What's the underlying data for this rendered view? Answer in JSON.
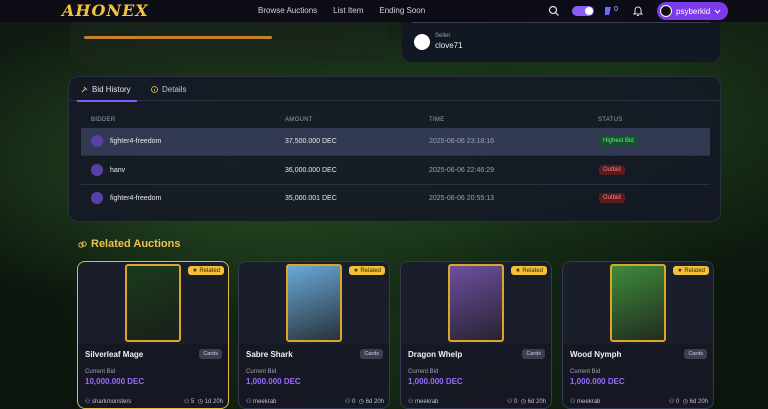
{
  "header": {
    "logo": "AHONEX",
    "nav": [
      "Browse Auctions",
      "List Item",
      "Ending Soon"
    ],
    "credits": "0",
    "username": "psyberkid"
  },
  "seller": {
    "label": "Seller",
    "name": "clove71"
  },
  "tabs": {
    "bid_history": "Bid History",
    "details": "Details"
  },
  "bid_table": {
    "headers": [
      "BIDDER",
      "AMOUNT",
      "TIME",
      "STATUS"
    ],
    "rows": [
      {
        "bidder": "fighter4-freedom",
        "amount": "37,500.000 DEC",
        "time": "2025-06-06 23:18:16",
        "status": "Highest Bid"
      },
      {
        "bidder": "hanv",
        "amount": "36,000.000 DEC",
        "time": "2025-06-06 22:46:29",
        "status": "Outbid"
      },
      {
        "bidder": "fighter4-freedom",
        "amount": "35,000.001 DEC",
        "time": "2025-06-06 20:55:13",
        "status": "Outbid"
      }
    ]
  },
  "related": {
    "title": "Related Auctions",
    "cards": [
      {
        "name": "Silverleaf Mage",
        "category": "Cards",
        "badge": "Related",
        "bid_label": "Current Bid",
        "price": "10,000.000 DEC",
        "seller": "sharkmonsters",
        "bids": "5",
        "time_left": "1d 20h",
        "art_color": "#1b3a1b"
      },
      {
        "name": "Sabre Shark",
        "category": "Cards",
        "badge": "Related",
        "bid_label": "Current Bid",
        "price": "1,000.000 DEC",
        "seller": "meekrab",
        "bids": "0",
        "time_left": "6d 20h",
        "art_color": "#6aa9d8"
      },
      {
        "name": "Dragon Whelp",
        "category": "Cards",
        "badge": "Related",
        "bid_label": "Current Bid",
        "price": "1,000.000 DEC",
        "seller": "meekrab",
        "bids": "0",
        "time_left": "6d 20h",
        "art_color": "#6d4fa0"
      },
      {
        "name": "Wood Nymph",
        "category": "Cards",
        "badge": "Related",
        "bid_label": "Current Bid",
        "price": "1,000.000 DEC",
        "seller": "meekrab",
        "bids": "0",
        "time_left": "6d 20h",
        "art_color": "#3f8a3a"
      }
    ]
  },
  "colors": {
    "accent": "#7c3aed",
    "gold": "#f0c24b",
    "price": "#9c6bff"
  }
}
